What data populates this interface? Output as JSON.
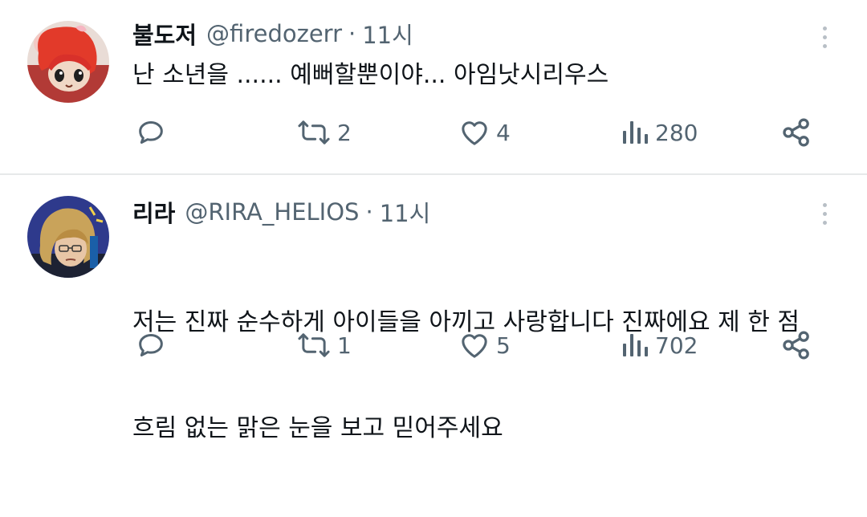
{
  "tweets": [
    {
      "author_name": "불도저",
      "handle": "@firedozerr",
      "separator": "·",
      "time": "11시",
      "text": "난 소년을 ...... 예뻐할뿐이야... 아임낫시리우스",
      "replies": "",
      "retweets": "2",
      "likes": "4",
      "views": "280"
    },
    {
      "author_name": "리라",
      "handle": "@RIRA_HELIOS",
      "separator": "·",
      "time": "11시",
      "text_line1": "저는 진짜 순수하게 아이들을 아끼고 사랑합니다 진짜에요 제 한 점",
      "text_line2": "흐림 없는 맑은 눈을 보고 믿어주세요",
      "replies": "",
      "retweets": "1",
      "likes": "5",
      "views": "702"
    }
  ],
  "icons": {
    "reply": "reply-icon",
    "retweet": "retweet-icon",
    "like": "heart-icon",
    "views": "views-icon",
    "share": "share-icon",
    "more": "more-icon"
  },
  "colors": {
    "secondary_text": "#536471",
    "divider": "#e7e9ea"
  }
}
